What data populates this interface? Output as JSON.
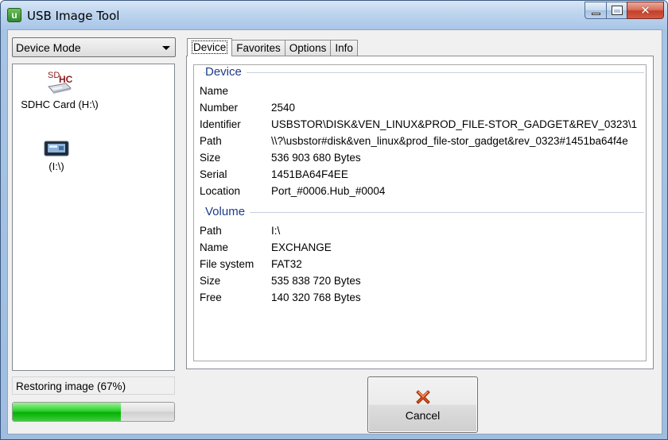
{
  "window": {
    "title": "USB Image Tool",
    "icon_name": "usb-image-tool-app-icon",
    "close_glyph": "✕"
  },
  "left": {
    "mode_select": {
      "value": "Device Mode"
    },
    "devices": [
      {
        "label": "SDHC Card (H:\\)",
        "icon": "sdhc-card-icon",
        "icon_text": "SD",
        "icon_sub": "HC"
      },
      {
        "label": "(I:\\)",
        "icon": "usb-drive-icon"
      }
    ],
    "status_text": "Restoring image (67%)",
    "progress": 0.67,
    "progress_color": "#06b006"
  },
  "tabs": [
    {
      "label": "Device",
      "active": true
    },
    {
      "label": "Favorites",
      "active": false
    },
    {
      "label": "Options",
      "active": false
    },
    {
      "label": "Info",
      "active": false
    }
  ],
  "device_section": {
    "title": "Device",
    "rows": [
      {
        "key": "Name",
        "value": ""
      },
      {
        "key": "Number",
        "value": "2540"
      },
      {
        "key": "Identifier",
        "value": "USBSTOR\\DISK&VEN_LINUX&PROD_FILE-STOR_GADGET&REV_0323\\1"
      },
      {
        "key": "Path",
        "value": "\\\\?\\usbstor#disk&ven_linux&prod_file-stor_gadget&rev_0323#1451ba64f4e"
      },
      {
        "key": "Size",
        "value": "536 903 680 Bytes"
      },
      {
        "key": "Serial",
        "value": "1451BA64F4EE"
      },
      {
        "key": "Location",
        "value": "Port_#0006.Hub_#0004"
      }
    ]
  },
  "volume_section": {
    "title": "Volume",
    "rows": [
      {
        "key": "Path",
        "value": "I:\\"
      },
      {
        "key": "Name",
        "value": "EXCHANGE"
      },
      {
        "key": "File system",
        "value": "FAT32"
      },
      {
        "key": "Size",
        "value": "535 838 720 Bytes"
      },
      {
        "key": "Free",
        "value": "140 320 768 Bytes"
      }
    ]
  },
  "cancel_button": {
    "label": "Cancel",
    "icon": "cancel-x-icon",
    "icon_color": "#e0561a"
  },
  "colors": {
    "section_title": "#1e3a8a",
    "accent_green": "#2bd02a"
  }
}
